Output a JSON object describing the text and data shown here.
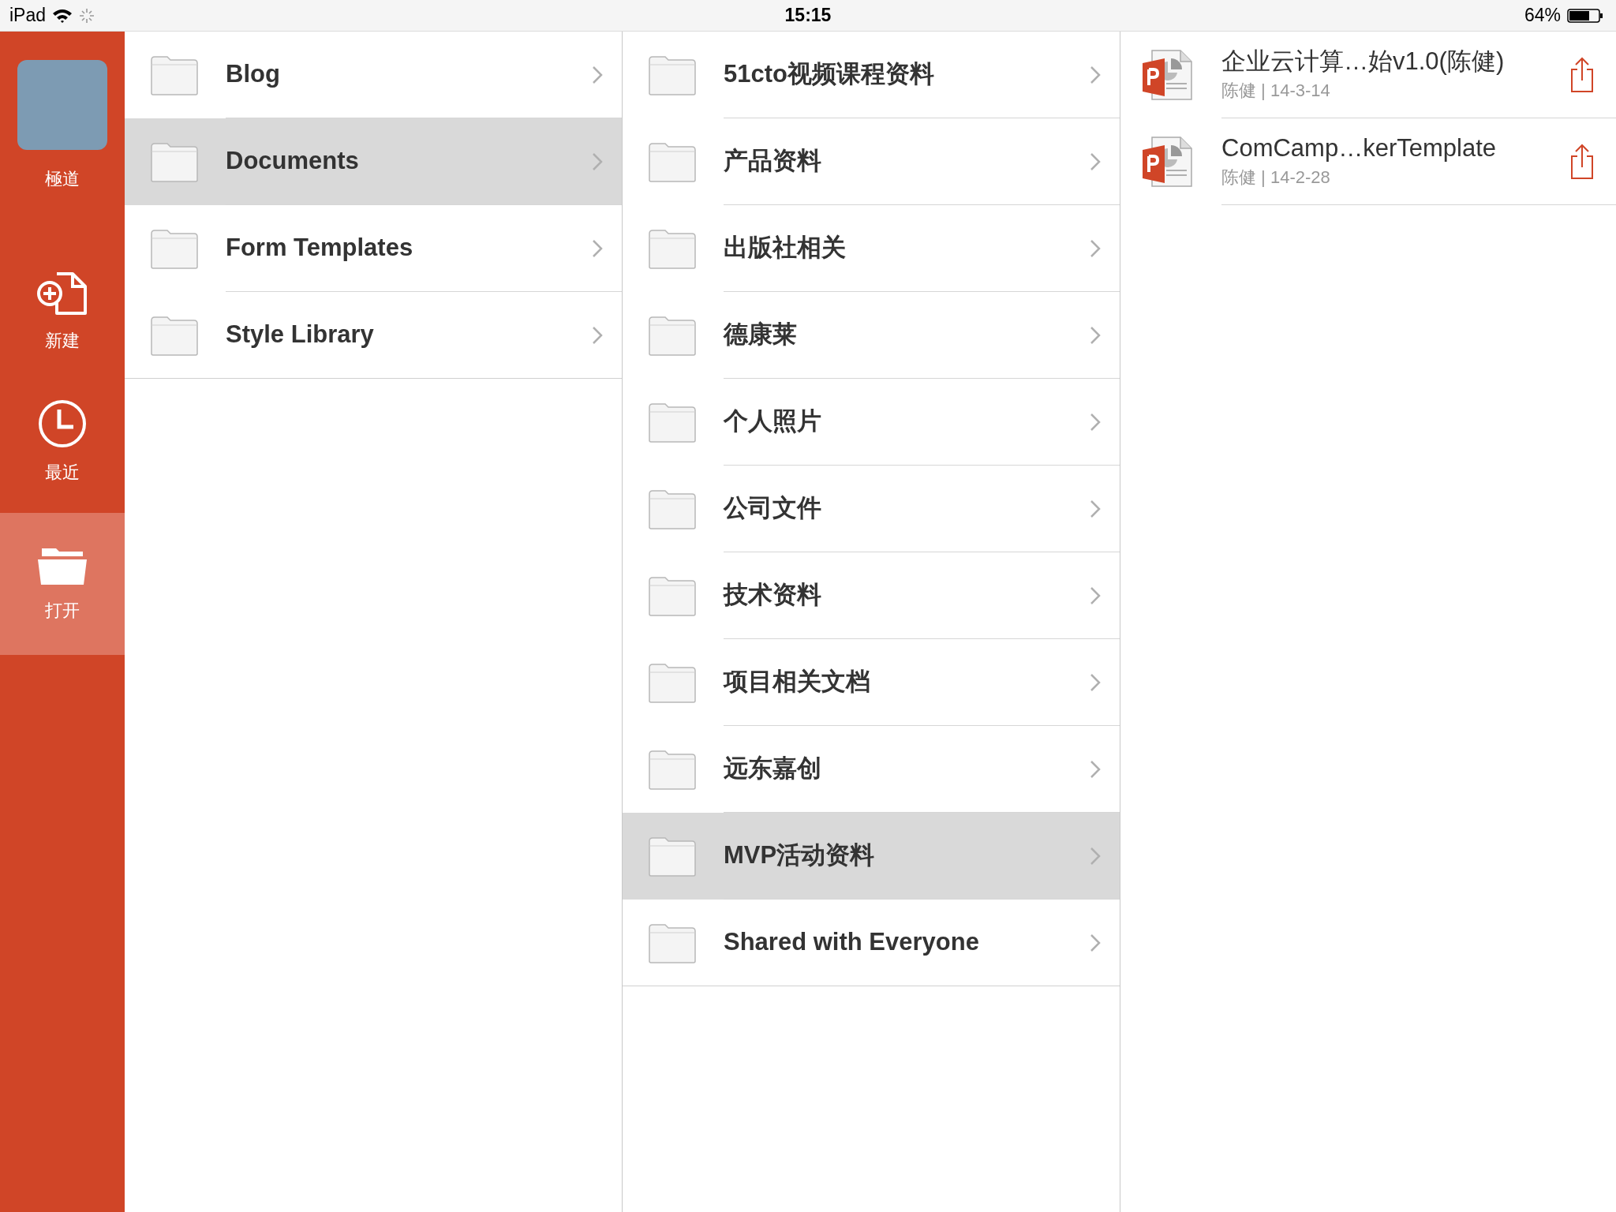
{
  "status_bar": {
    "device": "iPad",
    "time": "15:15",
    "battery": "64%"
  },
  "sidebar": {
    "user": {
      "name": "極道"
    },
    "items": [
      {
        "kind": "new",
        "label": "新建",
        "selected": false
      },
      {
        "kind": "recent",
        "label": "最近",
        "selected": false
      },
      {
        "kind": "open",
        "label": "打开",
        "selected": true
      }
    ]
  },
  "columns": [
    {
      "items": [
        {
          "label": "Blog",
          "selected": false
        },
        {
          "label": "Documents",
          "selected": true
        },
        {
          "label": "Form Templates",
          "selected": false
        },
        {
          "label": "Style Library",
          "selected": false
        }
      ]
    },
    {
      "items": [
        {
          "label": "51cto视频课程资料",
          "selected": false
        },
        {
          "label": "产品资料",
          "selected": false
        },
        {
          "label": "出版社相关",
          "selected": false
        },
        {
          "label": "德康莱",
          "selected": false
        },
        {
          "label": "个人照片",
          "selected": false
        },
        {
          "label": "公司文件",
          "selected": false
        },
        {
          "label": "技术资料",
          "selected": false
        },
        {
          "label": "项目相关文档",
          "selected": false
        },
        {
          "label": "远东嘉创",
          "selected": false
        },
        {
          "label": "MVP活动资料",
          "selected": true
        },
        {
          "label": "Shared with Everyone",
          "selected": false
        }
      ]
    }
  ],
  "files": [
    {
      "title": "企业云计算…始v1.0(陈健)",
      "meta": "陈健 | 14-3-14"
    },
    {
      "title": "ComCamp…kerTemplate",
      "meta": "陈健 | 14-2-28"
    }
  ]
}
